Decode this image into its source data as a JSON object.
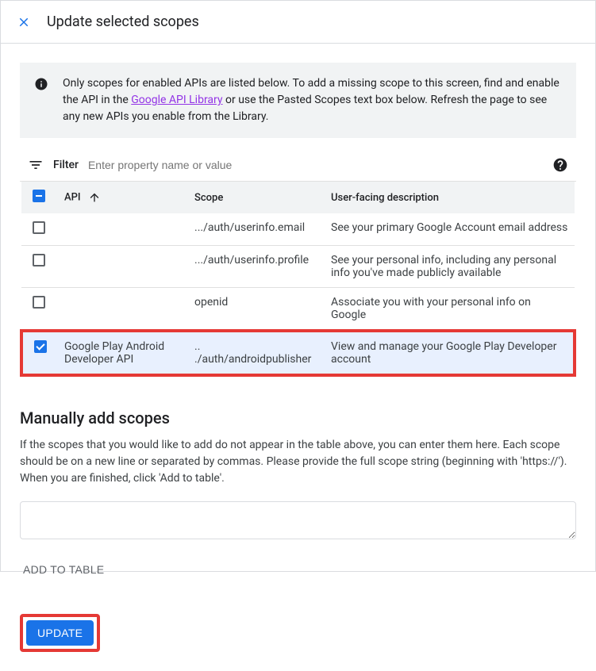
{
  "header": {
    "title": "Update selected scopes"
  },
  "banner": {
    "text_before_link": "Only scopes for enabled APIs are listed below. To add a missing scope to this screen, find and enable the API in the ",
    "link_text": "Google API Library",
    "text_after_link": " or use the Pasted Scopes text box below. Refresh the page to see any new APIs you enable from the Library."
  },
  "filter": {
    "label": "Filter",
    "placeholder": "Enter property name or value"
  },
  "table": {
    "headers": {
      "api": "API",
      "scope": "Scope",
      "description": "User-facing description"
    },
    "rows": [
      {
        "checked": false,
        "api": "",
        "scope": ".../auth/userinfo.email",
        "desc": "See your primary Google Account email address"
      },
      {
        "checked": false,
        "api": "",
        "scope": ".../auth/userinfo.profile",
        "desc": "See your personal info, including any personal info you've made publicly available"
      },
      {
        "checked": false,
        "api": "",
        "scope": "openid",
        "desc": "Associate you with your personal info on Google"
      },
      {
        "checked": true,
        "api": "Google Play Android Developer API",
        "scope": ".. ./auth/androidpublisher",
        "desc": "View and manage your Google Play Developer account"
      }
    ]
  },
  "manual": {
    "title": "Manually add scopes",
    "desc": "If the scopes that you would like to add do not appear in the table above, you can enter them here. Each scope should be on a new line or separated by commas. Please provide the full scope string (beginning with 'https://'). When you are finished, click 'Add to table'.",
    "add_button": "ADD TO TABLE"
  },
  "footer": {
    "update_button": "UPDATE"
  }
}
